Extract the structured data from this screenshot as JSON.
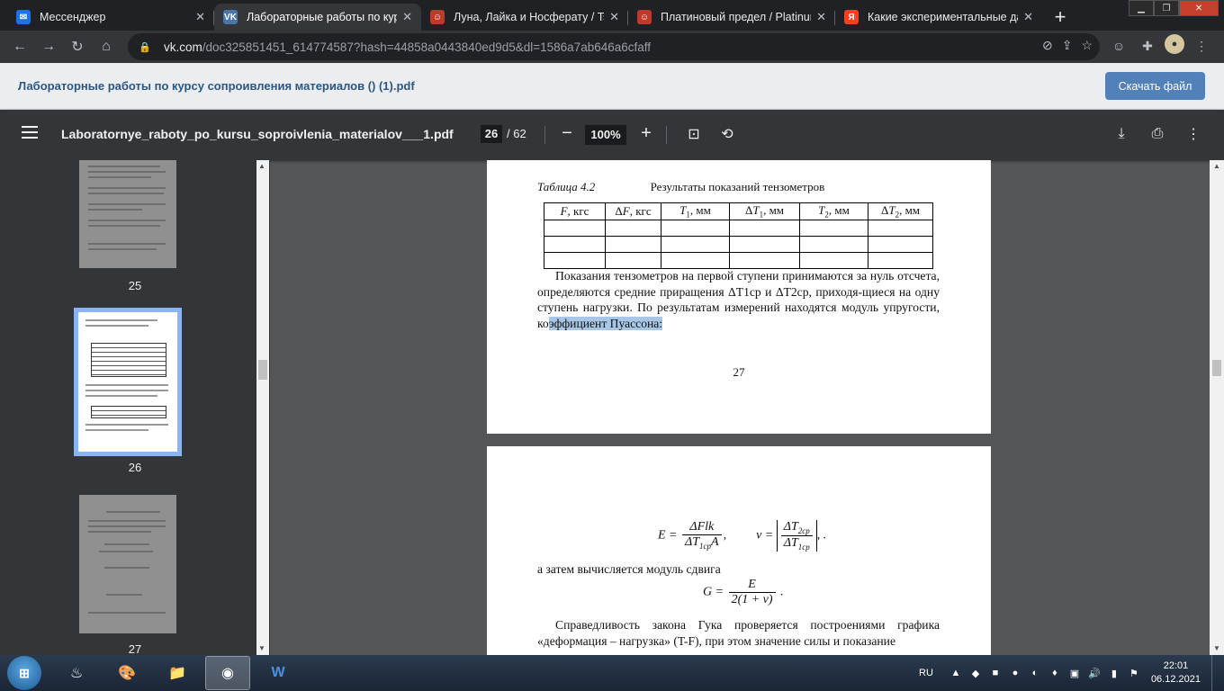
{
  "browser": {
    "tabs": [
      {
        "title": "Мессенджер",
        "icon": "messenger-icon",
        "color": "#1a73e8",
        "active": false
      },
      {
        "title": "Лабораторные работы по курс",
        "icon": "vk-icon",
        "color": "#4a76a8",
        "active": true
      },
      {
        "title": "Луна, Лайка и Носферату / Tsu",
        "icon": "tsu-icon",
        "color": "#c0392b",
        "active": false
      },
      {
        "title": "Платиновый предел / Platinum",
        "icon": "tsu-icon",
        "color": "#c0392b",
        "active": false
      },
      {
        "title": "Какие экспериментальные да",
        "icon": "yandex-icon",
        "color": "#fc3f1d",
        "active": false
      }
    ],
    "url_host": "vk.com",
    "url_path": "/doc325851451_614774587?hash=44858a0443840ed9d5&dl=1586a7ab646a6cfaff"
  },
  "vk": {
    "doc_title": "Лабораторные работы по курсу сопроивления материалов () (1).pdf",
    "download_label": "Скачать файл"
  },
  "pdf": {
    "filename": "Laboratornye_raboty_po_kursu_soproivlenia_materialov___1.pdf",
    "current_page": "26",
    "total_pages": "/ 62",
    "zoom": "100%",
    "thumbnails": [
      "25",
      "26",
      "27"
    ]
  },
  "page27": {
    "caption_label": "Таблица 4.2",
    "caption_title": "Результаты показаний тензометров",
    "table_headers": [
      "F, кгс",
      "ΔF, кгс",
      "T1, мм",
      "ΔT1, мм",
      "T2, мм",
      "ΔT2, мм"
    ],
    "para_start": "Показания тензометров на первой ступени принимаются за нуль отсчета, определяются средние приращения ΔT1ср и ΔT2ср, приходя-щиеся на одну ступень нагрузки. По результатам измерений находятся модуль упругости, ко",
    "para_highlight": "эффициент Пуассона:",
    "page_number": "27"
  },
  "page28": {
    "shear_text": "а затем вычисляется модуль сдвига",
    "hooke_text": "Справедливость закона Гука проверяется построениями графика «деформация – нагрузка» (T-F), при этом значение силы и показание"
  },
  "taskbar": {
    "lang": "RU",
    "time": "22:01",
    "date": "06.12.2021"
  }
}
